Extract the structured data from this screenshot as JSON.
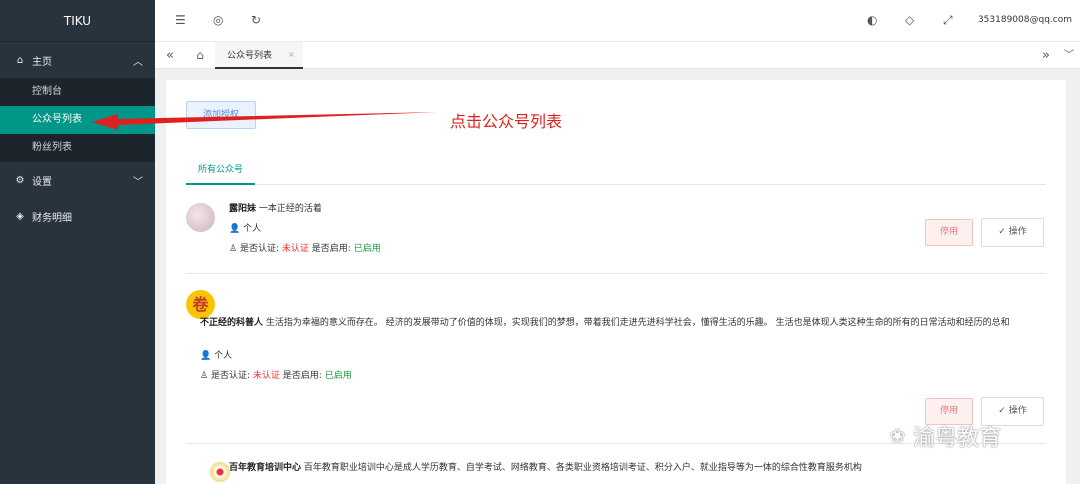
{
  "app": {
    "title": "TIKU"
  },
  "sidebar": {
    "home_label": "主页",
    "sub_items": [
      "控制台",
      "公众号列表",
      "粉丝列表"
    ],
    "settings_label": "设置",
    "finance_label": "财务明细"
  },
  "header": {
    "user": "353189008@qq.com"
  },
  "tabs": {
    "active_label": "公众号列表",
    "close": "×"
  },
  "main": {
    "auth_button": "添加授权",
    "sub_tab": "所有公众号",
    "accounts": [
      {
        "name": "露阳妹",
        "desc": "一本正经的活着",
        "type": "个人",
        "verified_label": "是否认证:",
        "verified_value": "未认证",
        "enabled_label": "是否启用:",
        "enabled_value": "已启用",
        "stop_button": "停用",
        "op_button": "操作"
      },
      {
        "name": "不正经的科普人",
        "desc": "生活指为幸福的意义而存在。 经济的发展带动了价值的体现，实现我们的梦想，带着我们走进先进科学社会，懂得生活的乐趣。 生活也是体现人类这种生命的所有的日常活动和经历的总和",
        "type": "个人",
        "verified_label": "是否认证:",
        "verified_value": "未认证",
        "enabled_label": "是否启用:",
        "enabled_value": "已启用",
        "stop_button": "停用",
        "op_button": "操作"
      },
      {
        "name": "百年教育培训中心",
        "desc": "百年教育职业培训中心是成人学历教育、自学考试、网络教育、各类职业资格培训考证、积分入户、就业指导等为一体的综合性教育服务机构"
      }
    ]
  },
  "annotation": {
    "text": "点击公众号列表"
  },
  "watermark": {
    "text": "渝粤教育"
  },
  "colors": {
    "sidebar_bg": "#28333e",
    "accent": "#009688",
    "annotation": "#e02020"
  }
}
